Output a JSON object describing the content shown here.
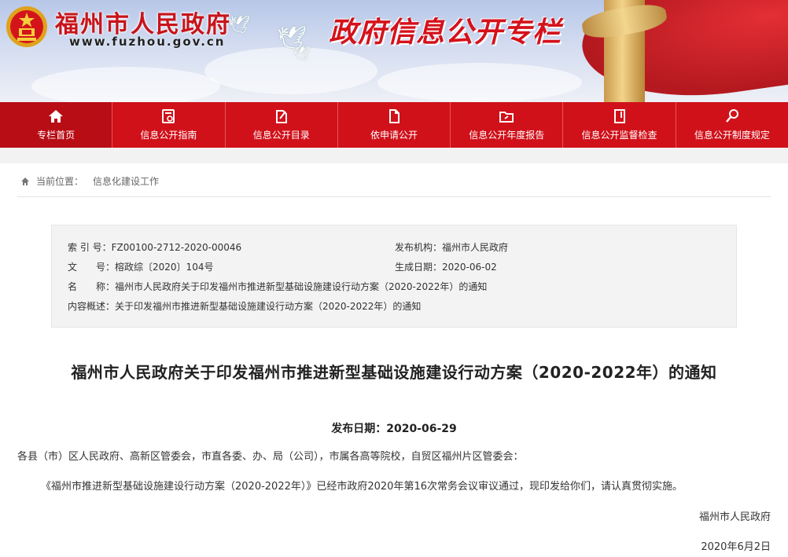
{
  "header": {
    "site_name": "福州市人民政府",
    "site_url": "www.fuzhou.gov.cn",
    "banner_title": "政府信息公开专栏"
  },
  "nav": {
    "items": [
      {
        "label": "专栏首页",
        "icon": "home-icon"
      },
      {
        "label": "信息公开指南",
        "icon": "guide-icon"
      },
      {
        "label": "信息公开目录",
        "icon": "catalog-icon"
      },
      {
        "label": "依申请公开",
        "icon": "apply-icon"
      },
      {
        "label": "信息公开年度报告",
        "icon": "report-icon"
      },
      {
        "label": "信息公开监督检查",
        "icon": "inspection-icon"
      },
      {
        "label": "信息公开制度规定",
        "icon": "regulation-icon"
      }
    ]
  },
  "breadcrumb": {
    "prefix": "当前位置：",
    "current": "信息化建设工作"
  },
  "meta": {
    "index_label": "索 引 号：",
    "index_value": "FZ00100-2712-2020-00046",
    "publisher_label": "发布机构：",
    "publisher_value": "福州市人民政府",
    "docno_label": "文　　号：",
    "docno_value": "榕政综〔2020〕104号",
    "created_label": "生成日期：",
    "created_value": "2020-06-02",
    "name_label": "名　　称：",
    "name_value": "福州市人民政府关于印发福州市推进新型基础设施建设行动方案（2020-2022年）的通知",
    "summary_label": "内容概述：",
    "summary_value": "关于印发福州市推进新型基础设施建设行动方案（2020-2022年）的通知"
  },
  "article": {
    "title": "福州市人民政府关于印发福州市推进新型基础设施建设行动方案（2020-2022年）的通知",
    "pubdate_label": "发布日期：",
    "pubdate_value": "2020-06-29",
    "salutation": "各县（市）区人民政府、高新区管委会，市直各委、办、局（公司），市属各高等院校，自贸区福州片区管委会：",
    "body": "《福州市推进新型基础设施建设行动方案（2020-2022年）》已经市政府2020年第16次常务会议审议通过，现印发给你们，请认真贯彻实施。",
    "signature": "福州市人民政府",
    "sign_date": "2020年6月2日"
  },
  "colors": {
    "nav_red": "#d0111a",
    "title_red": "#d4121b"
  }
}
